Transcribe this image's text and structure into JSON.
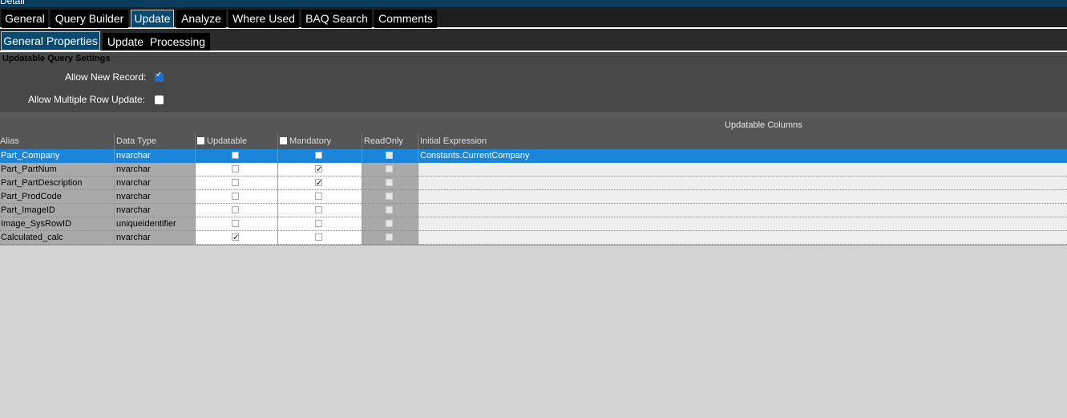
{
  "window": {
    "title": "Detail"
  },
  "main_tabs": [
    "General",
    "Query Builder",
    "Update",
    "Analyze",
    "Where Used",
    "BAQ Search",
    "Comments"
  ],
  "sub_tabs": [
    "General Properties",
    "Update  Processing"
  ],
  "settings": {
    "heading": "Updatable Query Settings",
    "allow_new_record_label": "Allow New Record:",
    "allow_new_record": true,
    "allow_multiple_row_update_label": "Allow Multiple Row Update:",
    "allow_multiple_row_update": false
  },
  "grid": {
    "group_header": "Updatable Columns",
    "columns": [
      "Alias",
      "Data Type",
      "Updatable",
      "Mandatory",
      "ReadOnly",
      "Initial Expression"
    ],
    "rows": [
      {
        "alias": "Part_Company",
        "type": "nvarchar",
        "updatable": false,
        "mandatory": false,
        "readonly": false,
        "expr": "Constants.CurrentCompany",
        "selected": true
      },
      {
        "alias": "Part_PartNum",
        "type": "nvarchar",
        "updatable": false,
        "mandatory": true,
        "readonly": false,
        "expr": ""
      },
      {
        "alias": "Part_PartDescription",
        "type": "nvarchar",
        "updatable": false,
        "mandatory": true,
        "readonly": false,
        "expr": ""
      },
      {
        "alias": "Part_ProdCode",
        "type": "nvarchar",
        "updatable": false,
        "mandatory": false,
        "readonly": false,
        "expr": ""
      },
      {
        "alias": "Part_ImageID",
        "type": "nvarchar",
        "updatable": false,
        "mandatory": false,
        "readonly": false,
        "expr": ""
      },
      {
        "alias": "Image_SysRowID",
        "type": "uniqueidentifier",
        "updatable": false,
        "mandatory": false,
        "readonly": false,
        "expr": ""
      },
      {
        "alias": "Calculated_calc",
        "type": "nvarchar",
        "updatable": true,
        "mandatory": false,
        "readonly": false,
        "expr": ""
      }
    ]
  },
  "colors": {
    "selection": "#1a84d8",
    "active_tab": "#0b4a6e",
    "panel": "#474747",
    "background": "#d4d4d4"
  },
  "icons": {
    "checkbox_checked": "check-icon",
    "checkbox_empty": "empty-checkbox"
  }
}
